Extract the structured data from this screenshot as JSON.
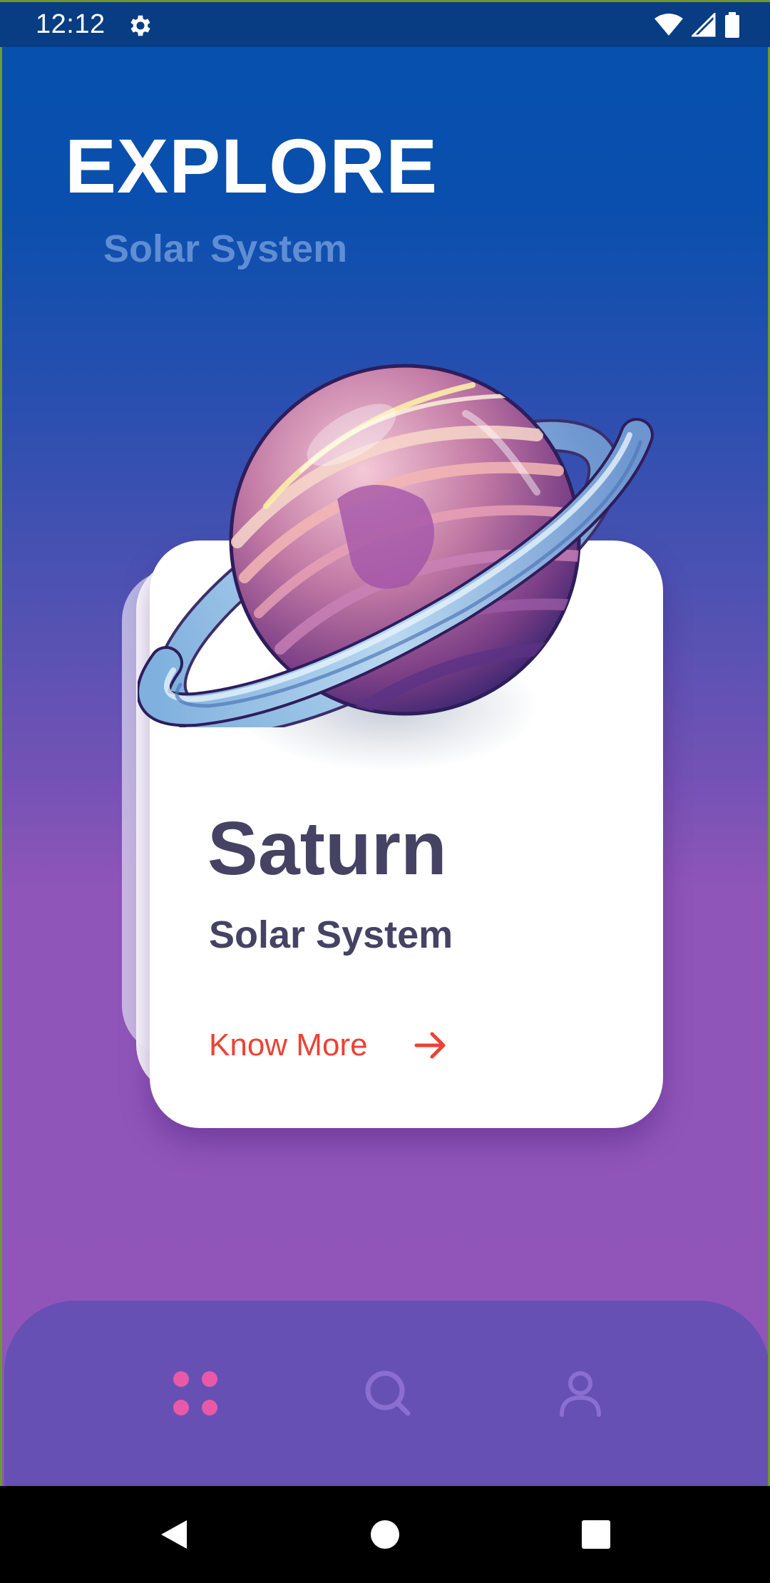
{
  "status_bar": {
    "time": "12:12",
    "settings_icon": "gear-icon",
    "wifi_icon": "wifi-icon",
    "signal_icon": "cell-signal-icon",
    "battery_icon": "battery-icon"
  },
  "header": {
    "title": "EXPLORE",
    "subtitle": "Solar System"
  },
  "card": {
    "planet_name": "Saturn",
    "planet_subtitle": "Solar System",
    "action_label": "Know More",
    "action_icon": "arrow-right-icon"
  },
  "bottom_nav": {
    "items": [
      {
        "icon": "grid-dots-icon",
        "active": true
      },
      {
        "icon": "search-icon",
        "active": false
      },
      {
        "icon": "profile-icon",
        "active": false
      }
    ]
  },
  "system_nav": {
    "items": [
      "back-icon",
      "home-icon",
      "recents-icon"
    ]
  },
  "colors": {
    "gradient_top": "#0751ae",
    "gradient_bottom": "#9155b9",
    "status_bar": "#083c83",
    "title": "#ffffff",
    "subtitle": "#5f8ed4",
    "card_text": "#454263",
    "accent": "#ea4335",
    "nav_bar": "#6750b3",
    "nav_active": "#e85aa8",
    "nav_inactive": "#8a6fd0"
  }
}
